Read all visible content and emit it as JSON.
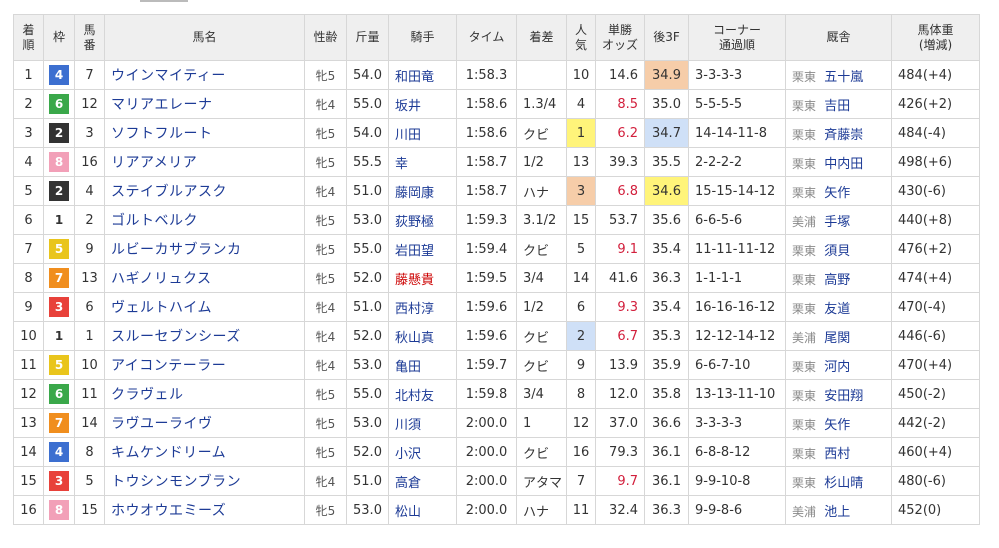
{
  "headers": {
    "finish": "着順",
    "frame": "枠",
    "number": "馬番",
    "horse": "馬名",
    "sexage": "性齢",
    "weight": "斤量",
    "jockey": "騎手",
    "time": "タイム",
    "margin": "着差",
    "pop": "人気",
    "odds": "単勝オッズ",
    "last3f": "後3F",
    "corner": "コーナー通過順",
    "stable": "厩舎",
    "bodyweight": "馬体重(増減)"
  },
  "frame_colors": {
    "1": {
      "bg": "#ffffff",
      "fg": "#333333"
    },
    "2": {
      "bg": "#333333",
      "fg": "#ffffff"
    },
    "3": {
      "bg": "#e8413a",
      "fg": "#ffffff"
    },
    "4": {
      "bg": "#3c6fd0",
      "fg": "#ffffff"
    },
    "5": {
      "bg": "#e9c51c",
      "fg": "#ffffff"
    },
    "6": {
      "bg": "#3aa84a",
      "fg": "#ffffff"
    },
    "7": {
      "bg": "#f08e1e",
      "fg": "#ffffff"
    },
    "8": {
      "bg": "#f2a0b8",
      "fg": "#ffffff"
    }
  },
  "rows": [
    {
      "finish": "1",
      "frame": "4",
      "number": "7",
      "horse": "ウインマイティー",
      "sexage": "牝5",
      "weight": "54.0",
      "jockey": "和田竜",
      "jockey_red": false,
      "time": "1:58.3",
      "margin": "",
      "pop": "10",
      "odds": "14.6",
      "odds_red": false,
      "last3f": "34.9",
      "l3rank": 3,
      "corner": "3-3-3-3",
      "loc": "栗東",
      "trainer": "五十嵐",
      "bodyweight": "484(+4)"
    },
    {
      "finish": "2",
      "frame": "6",
      "number": "12",
      "horse": "マリアエレーナ",
      "sexage": "牝4",
      "weight": "55.0",
      "jockey": "坂井",
      "jockey_red": false,
      "time": "1:58.6",
      "margin": "1.3/4",
      "pop": "4",
      "odds": "8.5",
      "odds_red": true,
      "last3f": "35.0",
      "l3rank": 0,
      "corner": "5-5-5-5",
      "loc": "栗東",
      "trainer": "吉田",
      "bodyweight": "426(+2)"
    },
    {
      "finish": "3",
      "frame": "2",
      "number": "3",
      "horse": "ソフトフルート",
      "sexage": "牝5",
      "weight": "54.0",
      "jockey": "川田",
      "jockey_red": false,
      "time": "1:58.6",
      "margin": "クビ",
      "pop": "1",
      "odds": "6.2",
      "odds_red": true,
      "last3f": "34.7",
      "l3rank": 2,
      "corner": "14-14-11-8",
      "loc": "栗東",
      "trainer": "斉藤崇",
      "bodyweight": "484(-4)"
    },
    {
      "finish": "4",
      "frame": "8",
      "number": "16",
      "horse": "リアアメリア",
      "sexage": "牝5",
      "weight": "55.5",
      "jockey": "幸",
      "jockey_red": false,
      "time": "1:58.7",
      "margin": "1/2",
      "pop": "13",
      "odds": "39.3",
      "odds_red": false,
      "last3f": "35.5",
      "l3rank": 0,
      "corner": "2-2-2-2",
      "loc": "栗東",
      "trainer": "中内田",
      "bodyweight": "498(+6)"
    },
    {
      "finish": "5",
      "frame": "2",
      "number": "4",
      "horse": "ステイブルアスク",
      "sexage": "牝4",
      "weight": "51.0",
      "jockey": "藤岡康",
      "jockey_red": false,
      "time": "1:58.7",
      "margin": "ハナ",
      "pop": "3",
      "odds": "6.8",
      "odds_red": true,
      "last3f": "34.6",
      "l3rank": 1,
      "corner": "15-15-14-12",
      "loc": "栗東",
      "trainer": "矢作",
      "bodyweight": "430(-6)"
    },
    {
      "finish": "6",
      "frame": "1",
      "number": "2",
      "horse": "ゴルトベルク",
      "sexage": "牝5",
      "weight": "53.0",
      "jockey": "荻野極",
      "jockey_red": false,
      "time": "1:59.3",
      "margin": "3.1/2",
      "pop": "15",
      "odds": "53.7",
      "odds_red": false,
      "last3f": "35.6",
      "l3rank": 0,
      "corner": "6-6-5-6",
      "loc": "美浦",
      "trainer": "手塚",
      "bodyweight": "440(+8)"
    },
    {
      "finish": "7",
      "frame": "5",
      "number": "9",
      "horse": "ルビーカサブランカ",
      "sexage": "牝5",
      "weight": "55.0",
      "jockey": "岩田望",
      "jockey_red": false,
      "time": "1:59.4",
      "margin": "クビ",
      "pop": "5",
      "odds": "9.1",
      "odds_red": true,
      "last3f": "35.4",
      "l3rank": 0,
      "corner": "11-11-11-12",
      "loc": "栗東",
      "trainer": "須貝",
      "bodyweight": "476(+2)"
    },
    {
      "finish": "8",
      "frame": "7",
      "number": "13",
      "horse": "ハギノリュクス",
      "sexage": "牝5",
      "weight": "52.0",
      "jockey": "藤懸貴",
      "jockey_red": true,
      "time": "1:59.5",
      "margin": "3/4",
      "pop": "14",
      "odds": "41.6",
      "odds_red": false,
      "last3f": "36.3",
      "l3rank": 0,
      "corner": "1-1-1-1",
      "loc": "栗東",
      "trainer": "高野",
      "bodyweight": "474(+4)"
    },
    {
      "finish": "9",
      "frame": "3",
      "number": "6",
      "horse": "ヴェルトハイム",
      "sexage": "牝4",
      "weight": "51.0",
      "jockey": "西村淳",
      "jockey_red": false,
      "time": "1:59.6",
      "margin": "1/2",
      "pop": "6",
      "odds": "9.3",
      "odds_red": true,
      "last3f": "35.4",
      "l3rank": 0,
      "corner": "16-16-16-12",
      "loc": "栗東",
      "trainer": "友道",
      "bodyweight": "470(-4)"
    },
    {
      "finish": "10",
      "frame": "1",
      "number": "1",
      "horse": "スルーセブンシーズ",
      "sexage": "牝4",
      "weight": "52.0",
      "jockey": "秋山真",
      "jockey_red": false,
      "time": "1:59.6",
      "margin": "クビ",
      "pop": "2",
      "odds": "6.7",
      "odds_red": true,
      "last3f": "35.3",
      "l3rank": 0,
      "corner": "12-12-14-12",
      "loc": "美浦",
      "trainer": "尾関",
      "bodyweight": "446(-6)"
    },
    {
      "finish": "11",
      "frame": "5",
      "number": "10",
      "horse": "アイコンテーラー",
      "sexage": "牝4",
      "weight": "53.0",
      "jockey": "亀田",
      "jockey_red": false,
      "time": "1:59.7",
      "margin": "クビ",
      "pop": "9",
      "odds": "13.9",
      "odds_red": false,
      "last3f": "35.9",
      "l3rank": 0,
      "corner": "6-6-7-10",
      "loc": "栗東",
      "trainer": "河内",
      "bodyweight": "470(+4)"
    },
    {
      "finish": "12",
      "frame": "6",
      "number": "11",
      "horse": "クラヴェル",
      "sexage": "牝5",
      "weight": "55.0",
      "jockey": "北村友",
      "jockey_red": false,
      "time": "1:59.8",
      "margin": "3/4",
      "pop": "8",
      "odds": "12.0",
      "odds_red": false,
      "last3f": "35.8",
      "l3rank": 0,
      "corner": "13-13-11-10",
      "loc": "栗東",
      "trainer": "安田翔",
      "bodyweight": "450(-2)"
    },
    {
      "finish": "13",
      "frame": "7",
      "number": "14",
      "horse": "ラヴユーライヴ",
      "sexage": "牝5",
      "weight": "53.0",
      "jockey": "川須",
      "jockey_red": false,
      "time": "2:00.0",
      "margin": "1",
      "pop": "12",
      "odds": "37.0",
      "odds_red": false,
      "last3f": "36.6",
      "l3rank": 0,
      "corner": "3-3-3-3",
      "loc": "栗東",
      "trainer": "矢作",
      "bodyweight": "442(-2)"
    },
    {
      "finish": "14",
      "frame": "4",
      "number": "8",
      "horse": "キムケンドリーム",
      "sexage": "牝5",
      "weight": "52.0",
      "jockey": "小沢",
      "jockey_red": false,
      "time": "2:00.0",
      "margin": "クビ",
      "pop": "16",
      "odds": "79.3",
      "odds_red": false,
      "last3f": "36.1",
      "l3rank": 0,
      "corner": "6-8-8-12",
      "loc": "栗東",
      "trainer": "西村",
      "bodyweight": "460(+4)"
    },
    {
      "finish": "15",
      "frame": "3",
      "number": "5",
      "horse": "トウシンモンブラン",
      "sexage": "牝4",
      "weight": "51.0",
      "jockey": "高倉",
      "jockey_red": false,
      "time": "2:00.0",
      "margin": "アタマ",
      "pop": "7",
      "odds": "9.7",
      "odds_red": true,
      "last3f": "36.1",
      "l3rank": 0,
      "corner": "9-9-10-8",
      "loc": "栗東",
      "trainer": "杉山晴",
      "bodyweight": "480(-6)"
    },
    {
      "finish": "16",
      "frame": "8",
      "number": "15",
      "horse": "ホウオウエミーズ",
      "sexage": "牝5",
      "weight": "53.0",
      "jockey": "松山",
      "jockey_red": false,
      "time": "2:00.0",
      "margin": "ハナ",
      "pop": "11",
      "odds": "32.4",
      "odds_red": false,
      "last3f": "36.3",
      "l3rank": 0,
      "corner": "9-9-8-6",
      "loc": "美浦",
      "trainer": "池上",
      "bodyweight": "452(0)"
    }
  ]
}
